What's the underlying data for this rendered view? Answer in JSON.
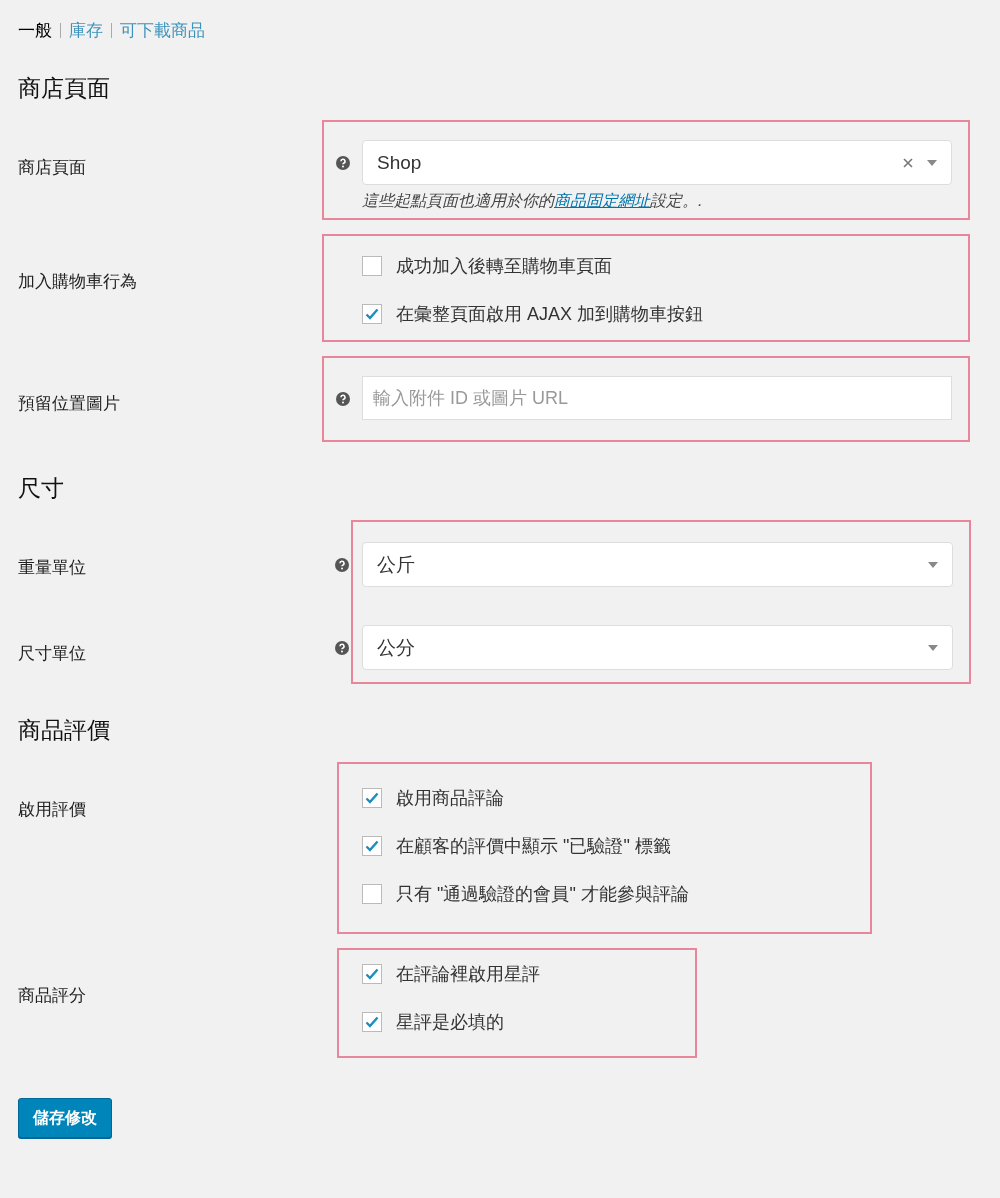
{
  "tabs": [
    {
      "label": "一般",
      "selected": true
    },
    {
      "label": "庫存",
      "selected": false
    },
    {
      "label": "可下載商品",
      "selected": false
    }
  ],
  "sections": [
    {
      "heading": "商店頁面",
      "groups": [
        {
          "highlighted": true,
          "rows": [
            {
              "label": "商店頁面",
              "kind": "select",
              "help": true,
              "value": "Shop",
              "clearable": true,
              "description": {
                "before": "這些起點頁面也適用於你的",
                "link": "商品固定網址",
                "after": "設定。."
              }
            }
          ]
        },
        {
          "highlighted": true,
          "rows": [
            {
              "label": "加入購物車行為",
              "kind": "checks",
              "options": [
                {
                  "label": "成功加入後轉至購物車頁面",
                  "checked": false
                },
                {
                  "label": "在彙整頁面啟用 AJAX 加到購物車按鈕",
                  "checked": true
                }
              ]
            }
          ]
        },
        {
          "highlighted": true,
          "rows": [
            {
              "label": "預留位置圖片",
              "kind": "text",
              "help": true,
              "placeholder": "輸入附件 ID 或圖片 URL"
            }
          ]
        }
      ]
    },
    {
      "heading": "尺寸",
      "groups": [
        {
          "highlighted": true,
          "rows": [
            {
              "label": "重量單位",
              "kind": "select",
              "help": true,
              "value": "公斤",
              "clearable": false
            },
            {
              "label": "尺寸單位",
              "kind": "select",
              "help": true,
              "value": "公分",
              "clearable": false
            }
          ]
        }
      ]
    },
    {
      "heading": "商品評價",
      "groups": [
        {
          "highlighted": true,
          "rows": [
            {
              "label": "啟用評價",
              "kind": "checks",
              "options": [
                {
                  "label": "啟用商品評論",
                  "checked": true
                },
                {
                  "label": "在顧客的評價中顯示 \"已驗證\" 標籤",
                  "checked": true
                },
                {
                  "label": "只有 \"通過驗證的會員\" 才能參與評論",
                  "checked": false
                }
              ]
            }
          ]
        },
        {
          "highlighted": true,
          "rows": [
            {
              "label": "商品評分",
              "kind": "checks",
              "options": [
                {
                  "label": "在評論裡啟用星評",
                  "checked": true
                },
                {
                  "label": "星評是必填的",
                  "checked": true
                }
              ]
            }
          ]
        }
      ]
    }
  ],
  "save_button": "儲存修改"
}
